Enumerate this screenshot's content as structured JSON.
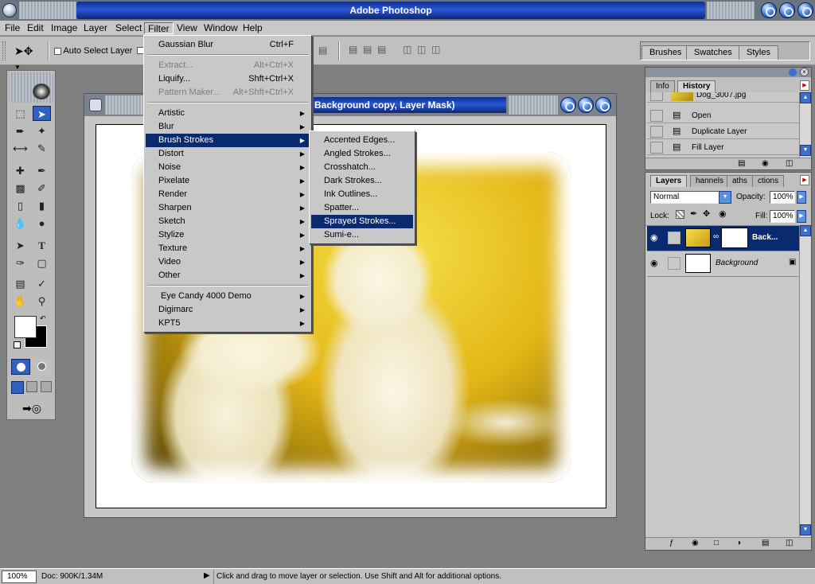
{
  "app": {
    "title": "Adobe Photoshop",
    "accent_color": "#0a2a70",
    "title_gradient": "#2a57d8"
  },
  "menubar": {
    "items": [
      "File",
      "Edit",
      "Image",
      "Layer",
      "Select",
      "Filter",
      "View",
      "Window",
      "Help"
    ],
    "open_menu": "Filter"
  },
  "options_bar": {
    "tool_icon": "move-tool-icon",
    "auto_select_label": "Auto Select Layer",
    "auto_select_checked": false,
    "palette_well_tabs": [
      "Brushes",
      "Swatches",
      "Styles"
    ]
  },
  "document": {
    "title": "Background copy, Layer Mask)",
    "image_description_icon": "puppies-photo"
  },
  "filter_menu": {
    "items": [
      {
        "label": "Gaussian Blur",
        "shortcut": "Ctrl+F",
        "disabled": false,
        "submenu": false
      },
      {
        "label": "Extract...",
        "shortcut": "Alt+Ctrl+X",
        "disabled": true,
        "submenu": false
      },
      {
        "label": "Liquify...",
        "shortcut": "Shft+Ctrl+X",
        "disabled": false,
        "submenu": false
      },
      {
        "label": "Pattern Maker...",
        "shortcut": "Alt+Shft+Ctrl+X",
        "disabled": true,
        "submenu": false
      },
      {
        "label": "Artistic",
        "submenu": true
      },
      {
        "label": "Blur",
        "submenu": true
      },
      {
        "label": "Brush Strokes",
        "submenu": true,
        "highlighted": true
      },
      {
        "label": "Distort",
        "submenu": true
      },
      {
        "label": "Noise",
        "submenu": true
      },
      {
        "label": "Pixelate",
        "submenu": true
      },
      {
        "label": "Render",
        "submenu": true
      },
      {
        "label": "Sharpen",
        "submenu": true
      },
      {
        "label": "Sketch",
        "submenu": true
      },
      {
        "label": "Stylize",
        "submenu": true
      },
      {
        "label": "Texture",
        "submenu": true
      },
      {
        "label": "Video",
        "submenu": true
      },
      {
        "label": "Other",
        "submenu": true
      },
      {
        "label": "Eye Candy 4000 Demo",
        "submenu": true
      },
      {
        "label": "Digimarc",
        "submenu": true
      },
      {
        "label": "KPT5",
        "submenu": true
      }
    ]
  },
  "brush_strokes_submenu": {
    "items": [
      "Accented Edges...",
      "Angled Strokes...",
      "Crosshatch...",
      "Dark Strokes...",
      "Ink Outlines...",
      "Spatter...",
      "Sprayed Strokes...",
      "Sumi-e..."
    ],
    "highlighted": "Sprayed Strokes..."
  },
  "history_palette": {
    "tabs": [
      "Info",
      "History"
    ],
    "active_tab": "History",
    "snapshot_name": "Dog_3007.jpg",
    "states": [
      "Open",
      "Duplicate Layer",
      "Fill Layer"
    ]
  },
  "layers_palette": {
    "tabs": [
      "Layers",
      "Channels",
      "Paths",
      "Actions"
    ],
    "tab_display": [
      "Layers",
      "hannels",
      "aths",
      "ctions"
    ],
    "active_tab": "Layers",
    "blend_mode": "Normal",
    "opacity_label": "Opacity:",
    "opacity": "100%",
    "lock_label": "Lock:",
    "fill_label": "Fill:",
    "fill": "100%",
    "layers": [
      {
        "name": "Back...",
        "selected": true,
        "has_mask": true
      },
      {
        "name": "Background",
        "selected": false,
        "locked": true
      }
    ]
  },
  "status_bar": {
    "zoom": "100%",
    "doc_info": "Doc: 900K/1.34M",
    "hint": "Click and drag to move layer or selection.  Use Shift and Alt for additional options."
  }
}
